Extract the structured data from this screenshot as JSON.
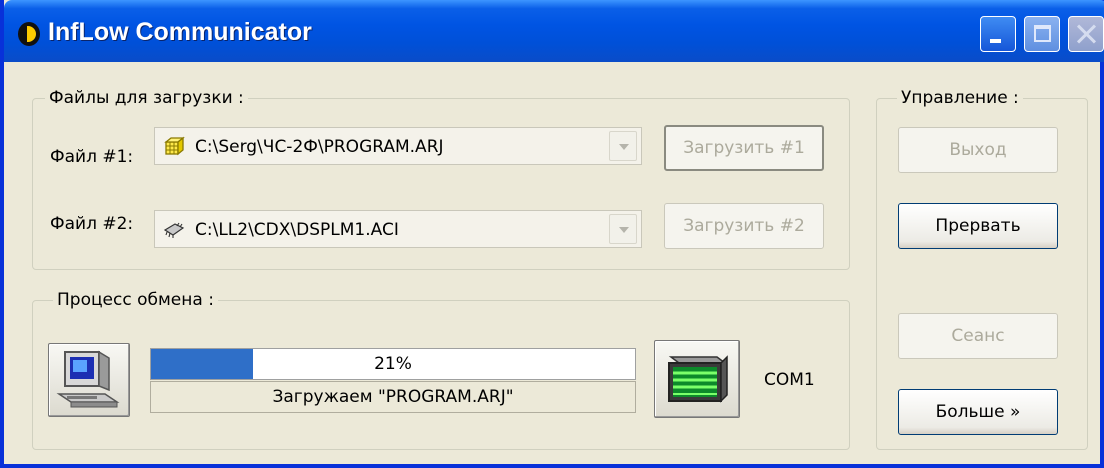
{
  "window": {
    "title": "InfLow Communicator"
  },
  "files": {
    "legend": "Файлы для загрузки :",
    "file1": {
      "label": "Файл #1:",
      "value": "C:\\Serg\\ЧС-2Ф\\PROGRAM.ARJ",
      "icon": "archive-file-icon",
      "button": "Загрузить #1"
    },
    "file2": {
      "label": "Файл #2:",
      "value": "C:\\LL2\\CDX\\DSPLM1.ACI",
      "icon": "chip-file-icon",
      "button": "Загрузить #2"
    }
  },
  "process": {
    "legend": "Процесс обмена :",
    "progress_percent": 21,
    "progress_text": "21%",
    "status": "Загружаем \"PROGRAM.ARJ\"",
    "port": "COM1",
    "accent_color": "#2f6fc8"
  },
  "control": {
    "legend": "Управление :",
    "exit": "Выход",
    "abort": "Прервать",
    "session": "Сеанс",
    "more": "Больше »"
  }
}
